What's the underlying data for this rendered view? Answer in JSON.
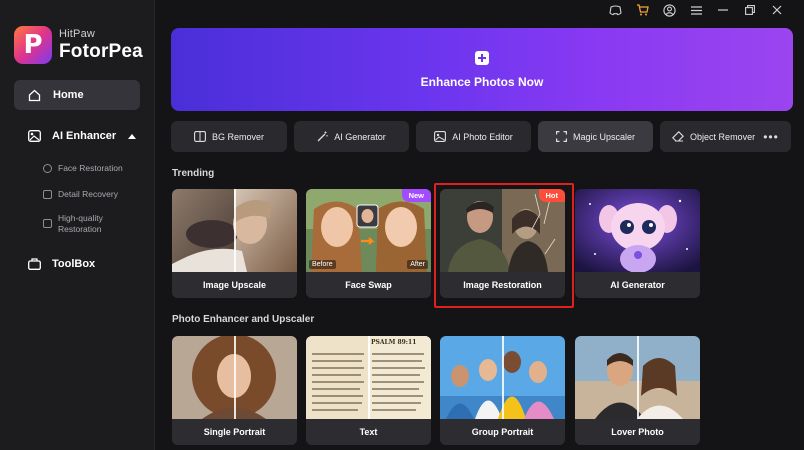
{
  "app": {
    "brand_small": "HitPaw",
    "brand_big": "FotorPea",
    "logo_letter": "P"
  },
  "sidebar": {
    "home": "Home",
    "ai_enhancer": "AI Enhancer",
    "sub_items": [
      {
        "label": "Face Restoration"
      },
      {
        "label": "Detail Recovery"
      },
      {
        "label": "High-quality\nRestoration"
      }
    ],
    "toolbox": "ToolBox"
  },
  "banner": {
    "title": "Enhance Photos Now"
  },
  "tools": [
    {
      "label": "BG Remover",
      "icon": "bg-remover-icon"
    },
    {
      "label": "AI Generator",
      "icon": "magic-wand-icon"
    },
    {
      "label": "AI Photo Editor",
      "icon": "photo-editor-icon"
    },
    {
      "label": "Magic Upscaler",
      "icon": "upscale-icon"
    },
    {
      "label": "Object Remover",
      "icon": "eraser-icon"
    }
  ],
  "more_label": "•••",
  "trending": {
    "title": "Trending",
    "cards": [
      {
        "label": "Image Upscale",
        "badge": ""
      },
      {
        "label": "Face Swap",
        "badge": "New",
        "before": "Before",
        "after": "After"
      },
      {
        "label": "Image Restoration",
        "badge": "Hot"
      },
      {
        "label": "AI Generator",
        "badge": ""
      }
    ]
  },
  "enhancer": {
    "title": "Photo Enhancer and Upscaler",
    "cards": [
      {
        "label": "Single Portrait"
      },
      {
        "label": "Text",
        "psalm": "PSALM 89:11"
      },
      {
        "label": "Group Portrait"
      },
      {
        "label": "Lover Photo"
      }
    ]
  },
  "colors": {
    "accent": "#7b3bf0",
    "highlight": "#e0201f",
    "hot": "#ff4d3a",
    "new": "#a34bff"
  }
}
